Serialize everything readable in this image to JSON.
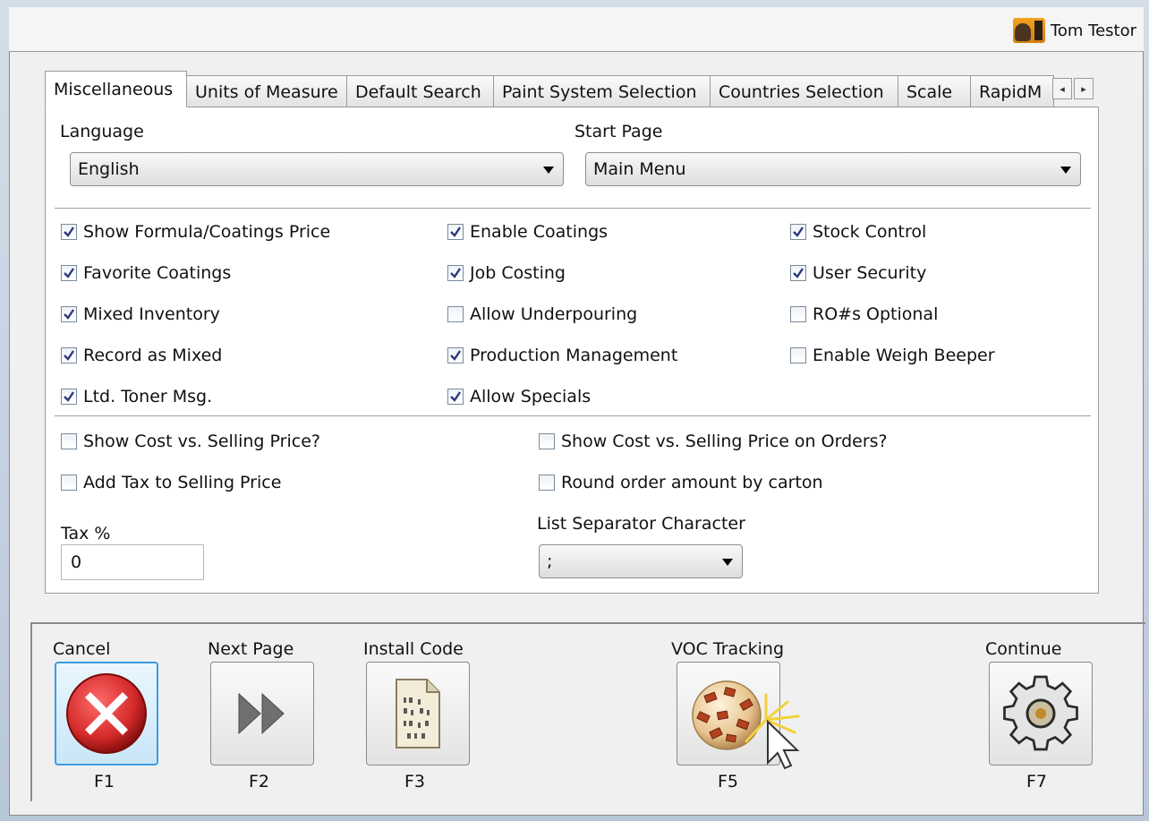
{
  "header": {
    "user_name": "Tom Testor",
    "user_icon": "user-avatar-icon"
  },
  "tabs": [
    {
      "label": "Miscellaneous",
      "active": true
    },
    {
      "label": "Units of Measure",
      "active": false
    },
    {
      "label": "Default Search",
      "active": false
    },
    {
      "label": "Paint System Selection",
      "active": false
    },
    {
      "label": "Countries Selection",
      "active": false
    },
    {
      "label": "Scale",
      "active": false
    },
    {
      "label": "RapidM",
      "active": false
    }
  ],
  "tab_scroll": {
    "left": "◂",
    "right": "▸"
  },
  "language": {
    "label": "Language",
    "value": "English"
  },
  "start_page": {
    "label": "Start Page",
    "value": "Main Menu"
  },
  "options": {
    "col1": [
      {
        "label": "Show Formula/Coatings Price",
        "checked": true
      },
      {
        "label": "Favorite Coatings",
        "checked": true
      },
      {
        "label": "Mixed Inventory",
        "checked": true
      },
      {
        "label": "Record as Mixed",
        "checked": true
      },
      {
        "label": "Ltd. Toner Msg.",
        "checked": true
      }
    ],
    "col2": [
      {
        "label": "Enable Coatings",
        "checked": true
      },
      {
        "label": "Job Costing",
        "checked": true
      },
      {
        "label": "Allow Underpouring",
        "checked": false
      },
      {
        "label": "Production Management",
        "checked": true
      },
      {
        "label": "Allow Specials",
        "checked": true
      }
    ],
    "col3": [
      {
        "label": "Stock Control",
        "checked": true
      },
      {
        "label": "User Security",
        "checked": true
      },
      {
        "label": "RO#s Optional",
        "checked": false
      },
      {
        "label": "Enable Weigh Beeper",
        "checked": false
      }
    ]
  },
  "pricing": {
    "show_cost": {
      "label": "Show Cost vs. Selling Price?",
      "checked": false
    },
    "add_tax": {
      "label": "Add Tax to Selling Price",
      "checked": false
    },
    "show_cost_orders": {
      "label": "Show Cost vs. Selling Price on Orders?",
      "checked": false
    },
    "round_order": {
      "label": "Round order amount by carton",
      "checked": false
    },
    "tax_label": "Tax %",
    "tax_value": "0",
    "separator_label": "List Separator Character",
    "separator_value": ";"
  },
  "buttons": [
    {
      "label": "Cancel",
      "key": "F1",
      "icon": "cancel-x-icon"
    },
    {
      "label": "Next Page",
      "key": "F2",
      "icon": "next-page-icon"
    },
    {
      "label": "Install Code",
      "key": "F3",
      "icon": "install-code-icon"
    },
    {
      "label": "VOC Tracking",
      "key": "F5",
      "icon": "voc-tracking-icon"
    },
    {
      "label": "Continue",
      "key": "F7",
      "icon": "gear-icon"
    }
  ],
  "colors": {
    "accent_focus": "#3c9ce0",
    "cancel_red": "#d42a2a"
  }
}
